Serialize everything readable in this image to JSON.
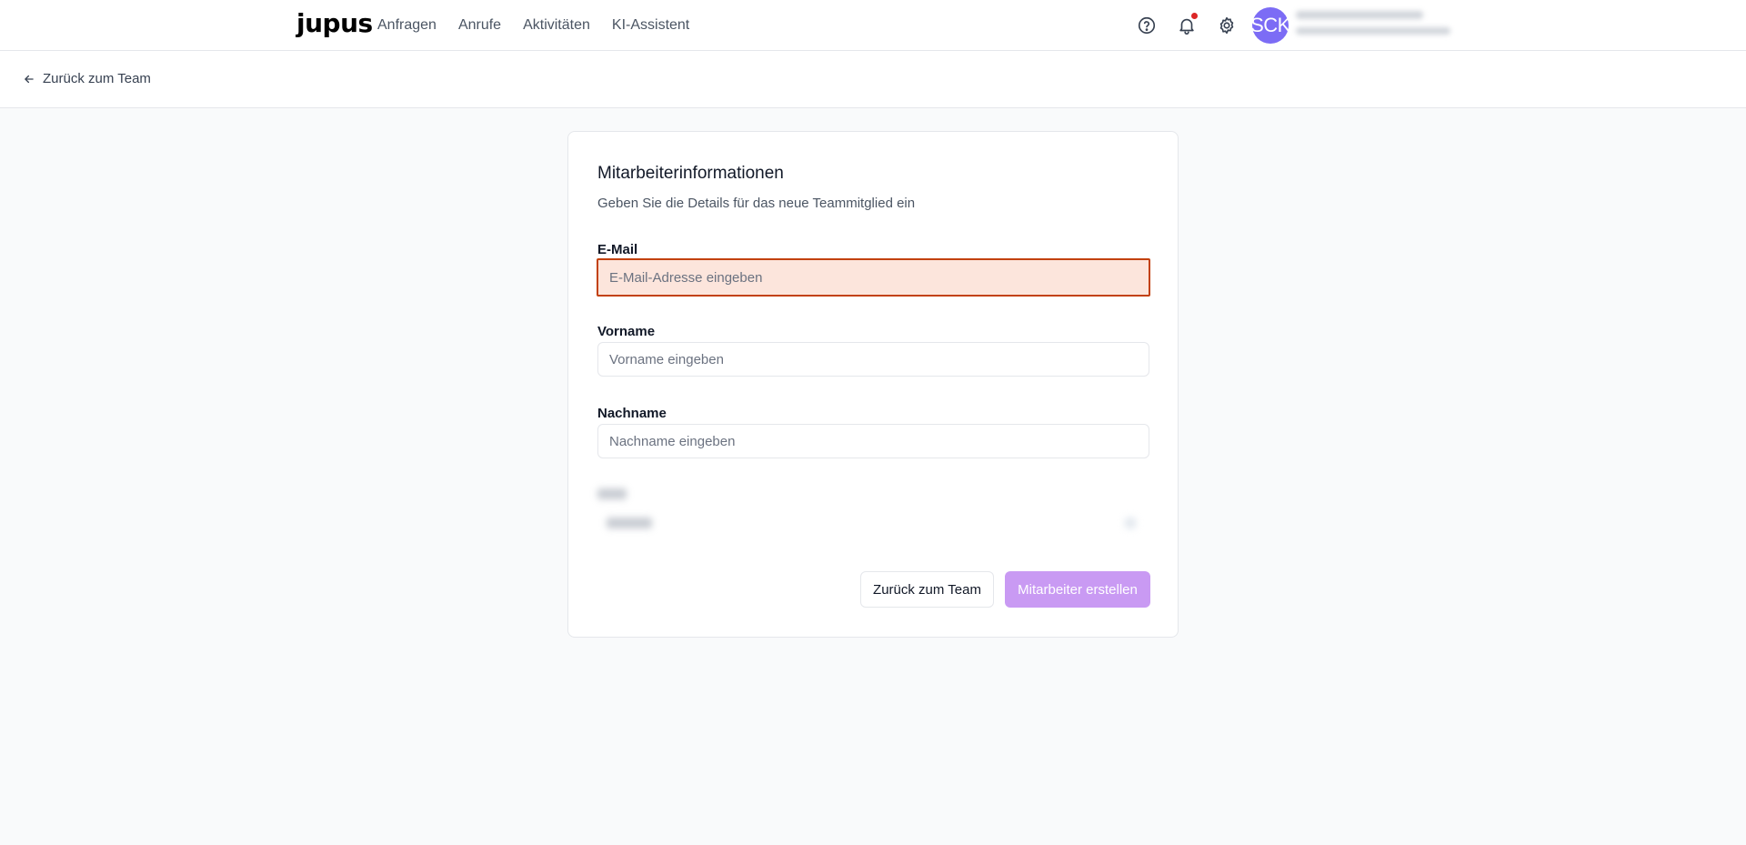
{
  "nav": {
    "logo": "jupus",
    "links": [
      "Anfragen",
      "Anrufe",
      "Aktivitäten",
      "KI-Assistent"
    ],
    "avatar_initials": "SCK"
  },
  "subheader": {
    "back_label": "Zurück zum Team"
  },
  "form": {
    "title": "Mitarbeiterinformationen",
    "description": "Geben Sie die Details für das neue Teammitglied ein",
    "email": {
      "label": "E-Mail",
      "placeholder": "E-Mail-Adresse eingeben",
      "value": ""
    },
    "firstname": {
      "label": "Vorname",
      "placeholder": "Vorname eingeben",
      "value": ""
    },
    "lastname": {
      "label": "Nachname",
      "placeholder": "Nachname eingeben",
      "value": ""
    },
    "cancel_label": "Zurück zum Team",
    "submit_label": "Mitarbeiter erstellen"
  },
  "colors": {
    "accent_disabled": "#c99af3",
    "error_border": "#c2410c",
    "error_bg": "#fce5dc",
    "avatar": "#7c6cf5",
    "notification": "#dc2626"
  },
  "icons": {
    "help": "help-circle-icon",
    "notifications": "bell-icon",
    "settings": "gear-icon",
    "back": "arrow-left-icon"
  }
}
